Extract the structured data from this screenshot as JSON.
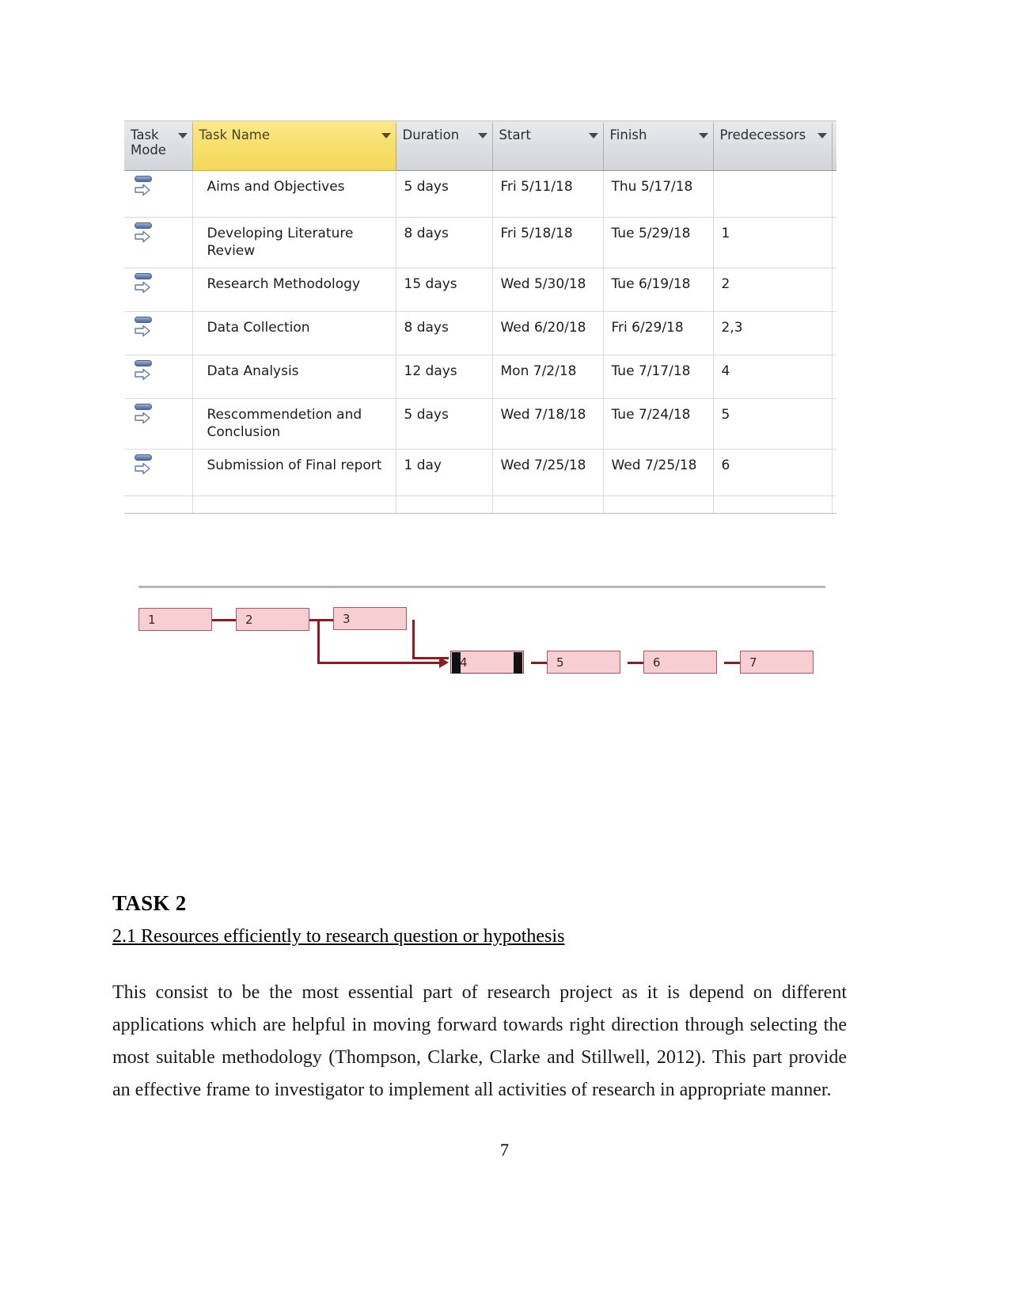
{
  "document": {
    "page_number": "7",
    "task_heading": "TASK 2",
    "subheading": "2.1 Resources efficiently to research question or hypothesis",
    "body_paragraph": "This consist to be the most essential part of research project as it is depend on different applications which are helpful in moving forward towards right direction through selecting the most suitable methodology (Thompson, Clarke, Clarke and Stillwell, 2012).  This part provide an effective frame to investigator to implement all activities of research in appropriate manner."
  },
  "project_table": {
    "columns": [
      {
        "key": "task_mode",
        "label": "Task Mode",
        "has_filter": true,
        "highlighted": false
      },
      {
        "key": "task_name",
        "label": "Task Name",
        "has_filter": true,
        "highlighted": true
      },
      {
        "key": "duration",
        "label": "Duration",
        "has_filter": true,
        "highlighted": false
      },
      {
        "key": "start",
        "label": "Start",
        "has_filter": true,
        "highlighted": false
      },
      {
        "key": "finish",
        "label": "Finish",
        "has_filter": true,
        "highlighted": false
      },
      {
        "key": "predecessors",
        "label": "Predecessors",
        "has_filter": true,
        "highlighted": false
      }
    ],
    "selected_column": "Task Name",
    "highlight_color": "#f7df6b",
    "rows": [
      {
        "mode_icon": "auto-schedule-icon",
        "task_name": "Aims and Objectives",
        "duration": "5 days",
        "start": "Fri 5/11/18",
        "finish": "Thu 5/17/18",
        "predecessors": ""
      },
      {
        "mode_icon": "auto-schedule-icon",
        "task_name": "Developing Literature Review",
        "duration": "8 days",
        "start": "Fri 5/18/18",
        "finish": "Tue 5/29/18",
        "predecessors": "1"
      },
      {
        "mode_icon": "auto-schedule-icon",
        "task_name": "Research Methodology",
        "duration": "15 days",
        "start": "Wed 5/30/18",
        "finish": "Tue 6/19/18",
        "predecessors": "2"
      },
      {
        "mode_icon": "auto-schedule-icon",
        "task_name": "Data Collection",
        "duration": "8 days",
        "start": "Wed 6/20/18",
        "finish": "Fri 6/29/18",
        "predecessors": "2,3"
      },
      {
        "mode_icon": "auto-schedule-icon",
        "task_name": "Data Analysis",
        "duration": "12 days",
        "start": "Mon 7/2/18",
        "finish": "Tue 7/17/18",
        "predecessors": "4"
      },
      {
        "mode_icon": "auto-schedule-icon",
        "task_name": "Rescommendetion and Conclusion",
        "duration": "5 days",
        "start": "Wed 7/18/18",
        "finish": "Tue 7/24/18",
        "predecessors": "5"
      },
      {
        "mode_icon": "auto-schedule-icon",
        "task_name": "Submission of Final report",
        "duration": "1 day",
        "start": "Wed 7/25/18",
        "finish": "Wed 7/25/18",
        "predecessors": "6"
      }
    ]
  },
  "network_diagram": {
    "node_fill": "#f7cfd2",
    "node_border": "#b4545c",
    "link_color": "#8e1b22",
    "selected_node": "4",
    "nodes": [
      {
        "id": "1",
        "label": "1",
        "selected": false
      },
      {
        "id": "2",
        "label": "2",
        "selected": false
      },
      {
        "id": "3",
        "label": "3",
        "selected": false
      },
      {
        "id": "4",
        "label": "4",
        "selected": true
      },
      {
        "id": "5",
        "label": "5",
        "selected": false
      },
      {
        "id": "6",
        "label": "6",
        "selected": false
      },
      {
        "id": "7",
        "label": "7",
        "selected": false
      }
    ],
    "edges": [
      {
        "from": "1",
        "to": "2"
      },
      {
        "from": "2",
        "to": "3"
      },
      {
        "from": "2",
        "to": "4"
      },
      {
        "from": "3",
        "to": "4"
      },
      {
        "from": "4",
        "to": "5"
      },
      {
        "from": "5",
        "to": "6"
      },
      {
        "from": "6",
        "to": "7"
      }
    ]
  }
}
